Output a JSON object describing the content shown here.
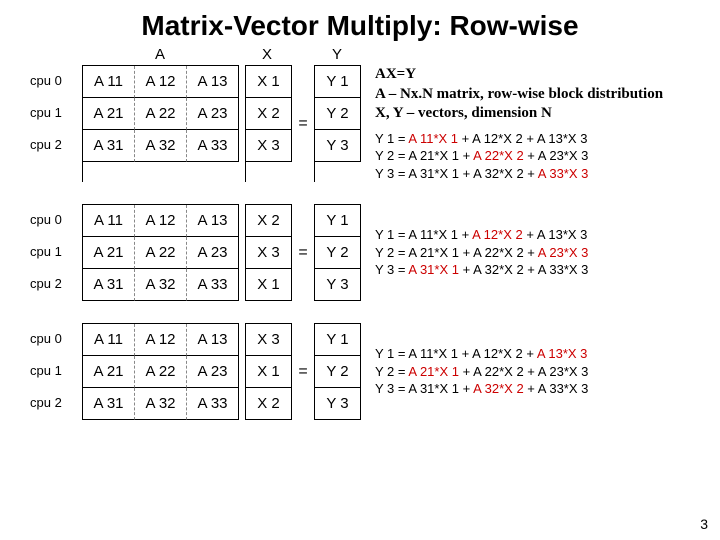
{
  "title": "Matrix-Vector Multiply: Row-wise",
  "labels": {
    "A": "A",
    "X": "X",
    "Y": "Y",
    "eq": "="
  },
  "cpu": [
    "cpu 0",
    "cpu 1",
    "cpu 2"
  ],
  "A": [
    [
      "A 11",
      "A 12",
      "A 13"
    ],
    [
      "A 21",
      "A 22",
      "A 23"
    ],
    [
      "A 31",
      "A 32",
      "A 33"
    ]
  ],
  "block1": {
    "X": [
      "X 1",
      "X 2",
      "X 3"
    ],
    "Y": [
      "Y 1",
      "Y 2",
      "Y 3"
    ]
  },
  "block2": {
    "X": [
      "X 2",
      "X 3",
      "X 1"
    ],
    "Y": [
      "Y 1",
      "Y 2",
      "Y 3"
    ]
  },
  "block3": {
    "X": [
      "X 3",
      "X 1",
      "X 2"
    ],
    "Y": [
      "Y 1",
      "Y 2",
      "Y 3"
    ]
  },
  "desc": {
    "l1": "AX=Y",
    "l2": "A – Nx.N matrix, row-wise block distribution",
    "l3": "X, Y – vectors, dimension N"
  },
  "eqs1": {
    "y1_a": "Y 1 = ",
    "y1_b": "A 11*X 1",
    "y1_c": " + A 12*X 2 + A 13*X 3",
    "y2_a": "Y 2 = A 21*X 1 + ",
    "y2_b": "A 22*X 2",
    "y2_c": " + A 23*X 3",
    "y3_a": "Y 3 = A 31*X 1 + A 32*X 2 + ",
    "y3_b": "A 33*X 3",
    "y3_c": ""
  },
  "eqs2": {
    "y1_a": "Y 1 = A 11*X 1 + ",
    "y1_b": "A 12*X 2",
    "y1_c": " + A 13*X 3",
    "y2_a": "Y 2 = A 21*X 1 + A 22*X 2 + ",
    "y2_b": "A 23*X 3",
    "y2_c": "",
    "y3_a": "Y 3 = ",
    "y3_b": "A 31*X 1",
    "y3_c": " + A 32*X 2 + A 33*X 3"
  },
  "eqs3": {
    "y1_a": "Y 1 = A 11*X 1 + A 12*X 2 + ",
    "y1_b": "A 13*X 3",
    "y1_c": "",
    "y2_a": "Y 2 = ",
    "y2_b": "A 21*X 1",
    "y2_c": " + A 22*X 2 + A 23*X 3",
    "y3_a": "Y 3 = A 31*X 1 + ",
    "y3_b": "A 32*X 2",
    "y3_c": " + A 33*X 3"
  },
  "slide_number": "3"
}
